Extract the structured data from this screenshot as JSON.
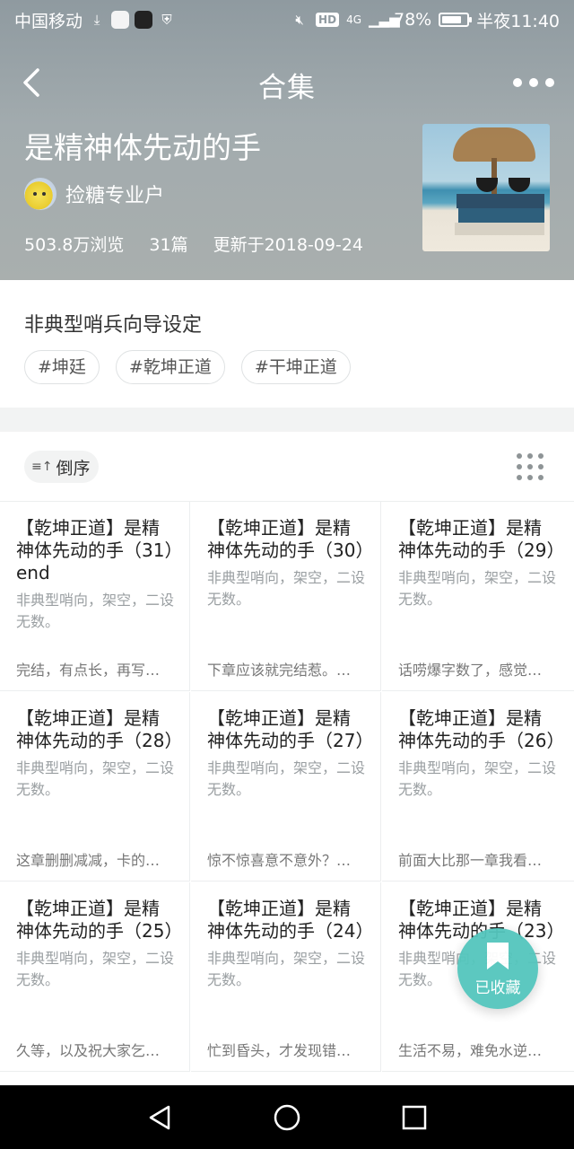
{
  "status_bar": {
    "carrier": "中国移动",
    "battery": "78%",
    "time": "半夜11:40",
    "hd": "HD",
    "network": "4G"
  },
  "navbar": {
    "title": "合集"
  },
  "collection": {
    "title": "是精神体先动的手",
    "author": "捡糖专业户",
    "views": "503.8万浏览",
    "count": "31篇",
    "updated": "更新于2018-09-24",
    "description": "非典型哨兵向导设定",
    "tags": [
      "#坤廷",
      "#乾坤正道",
      "#干坤正道"
    ]
  },
  "toolbar": {
    "sort_label": "倒序",
    "sort_icon": "≡↑"
  },
  "cards": [
    {
      "title": "【乾坤正道】是精神体先动的手（31）end",
      "excerpt": "非典型哨向，架空，二设无数。",
      "note": "完结，有点长，再写…"
    },
    {
      "title": "【乾坤正道】是精神体先动的手（30）",
      "excerpt": "非典型哨向，架空，二设无数。",
      "note": "下章应该就完结惹。…"
    },
    {
      "title": "【乾坤正道】是精神体先动的手（29）",
      "excerpt": "非典型哨向，架空，二设无数。",
      "note": "话唠爆字数了，感觉…"
    },
    {
      "title": "【乾坤正道】是精神体先动的手（28）",
      "excerpt": "非典型哨向，架空，二设无数。",
      "note": "这章删删减减，卡的…"
    },
    {
      "title": "【乾坤正道】是精神体先动的手（27）",
      "excerpt": "非典型哨向，架空，二设无数。",
      "note": "惊不惊喜意不意外？…"
    },
    {
      "title": "【乾坤正道】是精神体先动的手（26）",
      "excerpt": "非典型哨向，架空，二设无数。",
      "note": "前面大比那一章我看…"
    },
    {
      "title": "【乾坤正道】是精神体先动的手（25）",
      "excerpt": "非典型哨向，架空，二设无数。",
      "note": "久等，以及祝大家乞…"
    },
    {
      "title": "【乾坤正道】是精神体先动的手（24）",
      "excerpt": "非典型哨向，架空，二设无数。",
      "note": "忙到昏头，才发现错…"
    },
    {
      "title": "【乾坤正道】是精神体先动的手（23）",
      "excerpt": "非典型哨向，架空，二设无数。",
      "note": "生活不易，难免水逆…"
    }
  ],
  "fab": {
    "label": "已收藏"
  },
  "colors": {
    "accent": "#54c6bd",
    "header": "#a2abae"
  }
}
